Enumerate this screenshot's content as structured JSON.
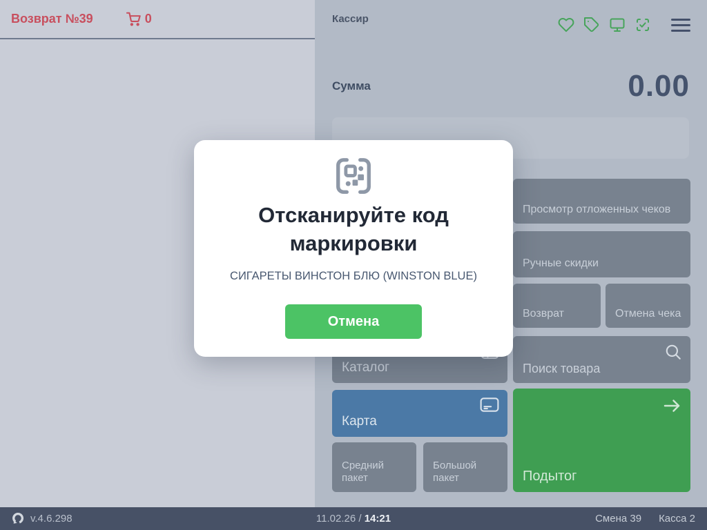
{
  "left_panel": {
    "title": "Возврат №39",
    "cart_count": "0"
  },
  "right_panel": {
    "cashier": "Кассир",
    "sum_label": "Сумма",
    "sum_value": "0.00",
    "buttons": {
      "deferred": "Просмотр отложенных чеков",
      "discounts": "Ручные скидки",
      "refund": "Возврат",
      "cancel_receipt": "Отмена чека",
      "search": "Поиск товара",
      "subtotal": "Подытог",
      "catalog": "Каталог",
      "card": "Карта",
      "medium_bag": "Средний пакет",
      "large_bag": "Большой пакет"
    }
  },
  "modal": {
    "title": "Отсканируйте код маркировки",
    "product": "СИГАРЕТЫ ВИНСТОН БЛЮ (WINSTON BLUE)",
    "cancel": "Отмена"
  },
  "footer": {
    "version": "v.4.6.298",
    "date": "11.02.26",
    "separator": "/",
    "time": "14:21",
    "shift": "Смена 39",
    "register": "Касса 2"
  },
  "icons": {
    "header": [
      "heart-icon",
      "tag-icon",
      "monitor-icon",
      "scan-check-icon",
      "menu-icon"
    ],
    "cart": "shopping-cart-icon",
    "modal": "qr-scan-icon",
    "search": "magnifier-icon",
    "subtotal": "arrow-right-icon",
    "card": "credit-card-icon",
    "catalog": "catalog-card-icon",
    "logo": "brand-ring-logo"
  },
  "colors": {
    "left_bg": "#c9cdd7",
    "right_bg": "#b2bac6",
    "button_gray": "#78828f",
    "button_blue": "#4b79a6",
    "button_green": "#3f9e52",
    "accent_green": "#4cc365",
    "icon_green": "#47a45b",
    "danger_red": "#c84f5e",
    "footer_bg": "#475166",
    "dark_text": "#45536d"
  }
}
